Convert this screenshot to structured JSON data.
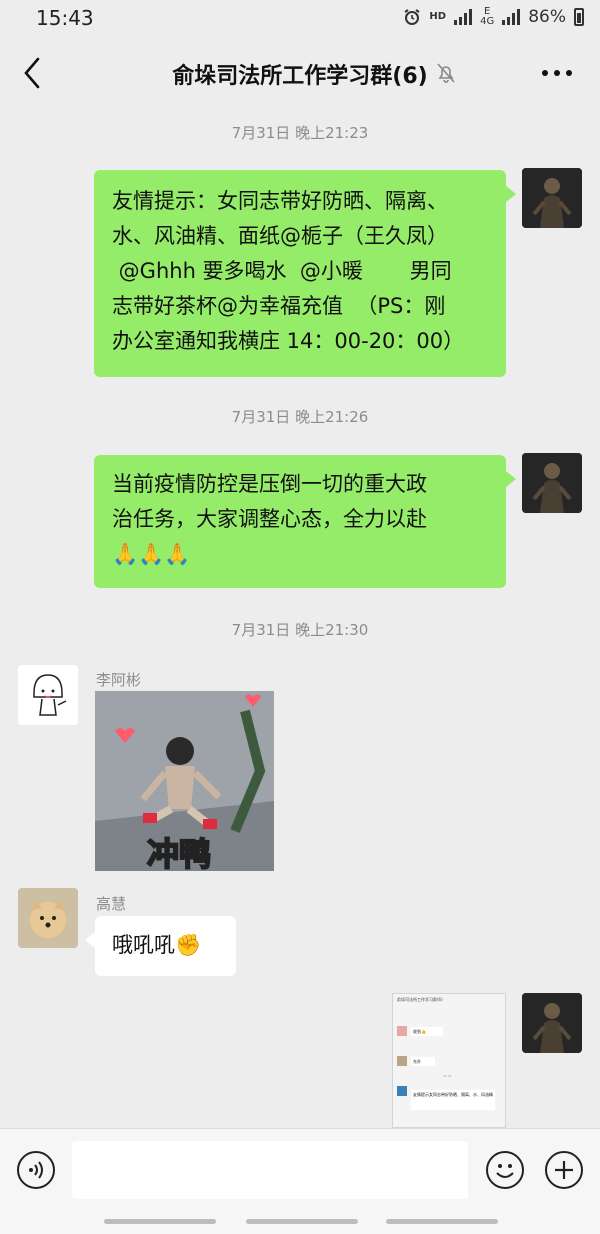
{
  "status": {
    "time": "15:43",
    "network_hd": "HD",
    "network_4g": "4G",
    "network_e": "E",
    "battery": "86%"
  },
  "chat": {
    "title": "俞垛司法所工作学习群(6)"
  },
  "timestamps": [
    "7月31日 晚上21:23",
    "7月31日 晚上21:26",
    "7月31日 晚上21:30"
  ],
  "messages": [
    {
      "lines": [
        "友情提示：女同志带好防晒、隔离、",
        "水、风油精、面纸@栀子（王久凤）",
        " @Ghhh 要多喝水  @小暖       男同",
        "志带好茶杯@为幸福充值  （PS：刚",
        "办公室通知我横庄 14：00-20：00）"
      ]
    },
    {
      "lines": [
        "当前疫情防控是压倒一切的重大政",
        "治任务，大家调整心态，全力以赴"
      ],
      "emoji": "🙏🙏🙏"
    },
    {
      "sender": "李阿彬",
      "sticker_text": "冲鸭"
    },
    {
      "sender": "高慧",
      "text": "哦吼吼✊"
    },
    {
      "shot": {
        "title": "俞垛司法所工作学习群(6)",
        "msg1": "收到👍",
        "msg2": "东升",
        "msg3": "友情提示女同志带好防晒、隔离、水、风油精",
        "time": "21:31"
      }
    }
  ]
}
